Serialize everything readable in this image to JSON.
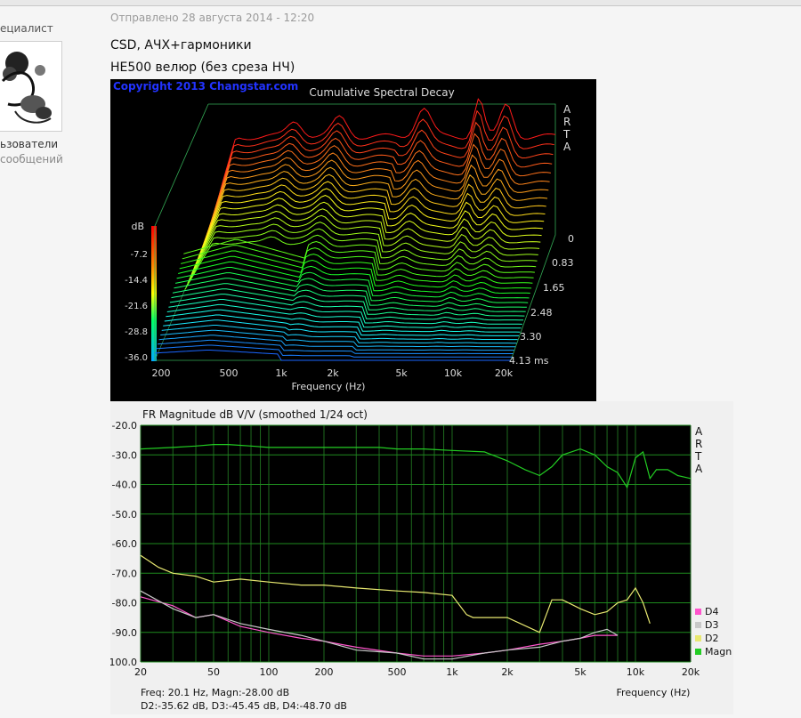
{
  "post": {
    "author_role": "ециалист",
    "author_group": "ьзователи",
    "author_messages": "сообщений",
    "sent_label": "Отправлено 28 августа 2014 - 12:20",
    "line1": "CSD, АЧХ+гармоники",
    "line2": "HE500 велюр (без среза НЧ)"
  },
  "chart_data": [
    {
      "type": "area",
      "title": "Cumulative Spectral Decay",
      "watermark": "Copyright 2013 Changstar.com",
      "brand": [
        "A",
        "R",
        "T",
        "A"
      ],
      "xlabel": "Frequency (Hz)",
      "x_ticks": [
        "200",
        "500",
        "1k",
        "2k",
        "5k",
        "10k",
        "20k"
      ],
      "y_axis_title": "dB",
      "y_ticks": [
        "-7.2",
        "-14.4",
        "-21.6",
        "-28.8",
        "-36.0"
      ],
      "time_ticks": [
        "0",
        "0.83",
        "1.65",
        "2.48",
        "3.30",
        "4.13 ms"
      ],
      "zlim_ms": [
        0,
        4.13
      ],
      "ylim_db": [
        -36.0,
        0
      ]
    },
    {
      "type": "line",
      "title": "FR Magnitude dB V/V (smoothed 1/24 oct)",
      "brand": [
        "A",
        "R",
        "T",
        "A"
      ],
      "xlabel": "Frequency (Hz)",
      "x_scale": "log",
      "x_ticks": [
        "20",
        "50",
        "100",
        "200",
        "500",
        "1k",
        "2k",
        "5k",
        "10k",
        "20k"
      ],
      "y_ticks": [
        "-20.0",
        "-30.0",
        "-40.0",
        "-50.0",
        "-60.0",
        "-70.0",
        "-80.0",
        "-90.0",
        "-100.0"
      ],
      "ylim": [
        -100,
        -20
      ],
      "grid": true,
      "legend_position": "bottom-right",
      "readout": [
        "Freq: 20.1 Hz, Magn:-28.00 dB",
        "D2:-35.62 dB, D3:-45.45 dB, D4:-48.70 dB"
      ],
      "series": [
        {
          "name": "Magn",
          "color": "#22cc22",
          "x": [
            20,
            30,
            40,
            50,
            60,
            80,
            100,
            150,
            200,
            300,
            400,
            500,
            700,
            1000,
            1500,
            2000,
            2500,
            3000,
            3500,
            4000,
            5000,
            6000,
            7000,
            8000,
            9000,
            10000,
            11000,
            12000,
            13000,
            15000,
            17000,
            20000
          ],
          "y": [
            -28,
            -27.5,
            -27,
            -26.5,
            -26.5,
            -27,
            -27.5,
            -27.5,
            -27.5,
            -27.5,
            -27.5,
            -28,
            -28,
            -28.5,
            -29,
            -32,
            -35,
            -37,
            -34,
            -30,
            -28,
            -30,
            -34,
            -36,
            -41,
            -31,
            -29,
            -38,
            -35,
            -35,
            -37,
            -38
          ]
        },
        {
          "name": "D2",
          "color": "#e8e870",
          "x": [
            20,
            25,
            30,
            40,
            50,
            70,
            100,
            150,
            200,
            300,
            500,
            700,
            1000,
            1200,
            1300,
            1500,
            2000,
            3000,
            3500,
            4000,
            5000,
            6000,
            7000,
            8000,
            9000,
            10000,
            11000,
            12000
          ],
          "y": [
            -64,
            -68,
            -70,
            -71,
            -73,
            -72,
            -73,
            -74,
            -74,
            -75,
            -76,
            -76.5,
            -77.5,
            -84,
            -85,
            -85,
            -85,
            -90,
            -79,
            -79,
            -82,
            -84,
            -83,
            -80,
            -79,
            -75,
            -80,
            -87
          ]
        },
        {
          "name": "D3",
          "color": "#c8c8c8",
          "x": [
            20,
            30,
            40,
            50,
            70,
            100,
            150,
            200,
            300,
            500,
            700,
            1000,
            1500,
            2000,
            3000,
            4000,
            5000,
            6000,
            7000,
            8000
          ],
          "y": [
            -76,
            -82,
            -85,
            -84,
            -87,
            -89,
            -91,
            -93,
            -96,
            -97,
            -99,
            -99,
            -97,
            -96,
            -95,
            -93,
            -92,
            -90,
            -89,
            -91
          ]
        },
        {
          "name": "D4",
          "color": "#ff55cc",
          "x": [
            20,
            30,
            40,
            50,
            70,
            100,
            150,
            200,
            300,
            500,
            700,
            1000,
            1500,
            2000,
            3000,
            4000,
            5000,
            6000,
            7000,
            8000
          ],
          "y": [
            -78,
            -81,
            -85,
            -84,
            -88,
            -90,
            -92,
            -93,
            -95,
            -97,
            -98,
            -98,
            -97,
            -96,
            -94,
            -93,
            -92,
            -91,
            -91,
            -91
          ]
        }
      ]
    }
  ]
}
